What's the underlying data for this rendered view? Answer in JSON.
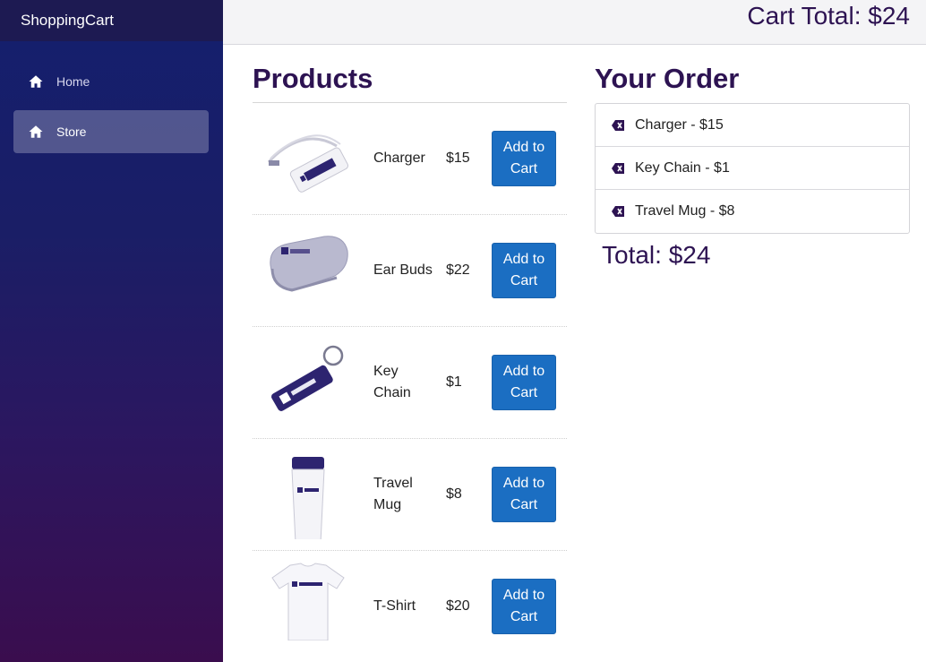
{
  "app": {
    "title": "ShoppingCart"
  },
  "nav": {
    "items": [
      {
        "label": "Home",
        "icon": "home-icon",
        "active": false
      },
      {
        "label": "Store",
        "icon": "home-icon",
        "active": true
      }
    ]
  },
  "header": {
    "cart_total": "Cart Total: $24"
  },
  "products": {
    "title": "Products",
    "button_label": "Add to Cart",
    "items": [
      {
        "name": "Charger",
        "price": "$15",
        "image": "charger-image"
      },
      {
        "name": "Ear Buds",
        "price": "$22",
        "image": "ear-buds-image"
      },
      {
        "name": "Key Chain",
        "price": "$1",
        "image": "key-chain-image"
      },
      {
        "name": "Travel Mug",
        "price": "$8",
        "image": "travel-mug-image"
      },
      {
        "name": "T-Shirt",
        "price": "$20",
        "image": "t-shirt-image"
      }
    ]
  },
  "order": {
    "title": "Your Order",
    "items": [
      {
        "label": "Charger - $15"
      },
      {
        "label": "Key Chain - $1"
      },
      {
        "label": "Travel Mug - $8"
      }
    ],
    "total": "Total: $24",
    "remove_icon": "backspace-icon"
  },
  "colors": {
    "sidebar_top": "#141f6e",
    "sidebar_bottom": "#3a0d4e",
    "accent_button": "#1b6ec2",
    "heading": "#2d1352"
  }
}
